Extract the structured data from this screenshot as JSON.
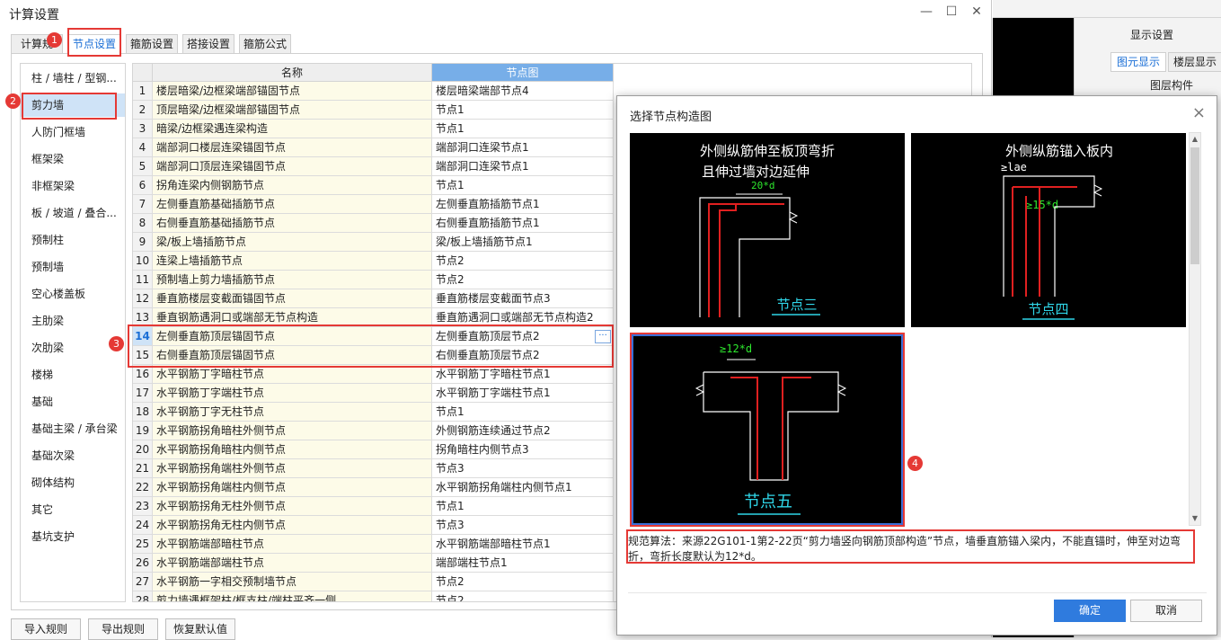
{
  "window": {
    "title": "计算设置"
  },
  "tabs": [
    "计算规",
    "节点设置",
    "箍筋设置",
    "搭接设置",
    "箍筋公式"
  ],
  "sidebar": {
    "items": [
      "柱 / 墙柱 / 型钢...",
      "剪力墙",
      "人防门框墙",
      "框架梁",
      "非框架梁",
      "板 / 坡道 / 叠合...",
      "预制柱",
      "预制墙",
      "空心楼盖板",
      "主肋梁",
      "次肋梁",
      "楼梯",
      "基础",
      "基础主梁 / 承台梁",
      "基础次梁",
      "砌体结构",
      "其它",
      "基坑支护"
    ],
    "selected": 1
  },
  "grid": {
    "headers": {
      "name": "名称",
      "node": "节点图"
    },
    "rows": [
      [
        "1",
        "楼层暗梁/边框梁端部锚固节点",
        "楼层暗梁端部节点4"
      ],
      [
        "2",
        "顶层暗梁/边框梁端部锚固节点",
        "节点1"
      ],
      [
        "3",
        "暗梁/边框梁遇连梁构造",
        "节点1"
      ],
      [
        "4",
        "端部洞口楼层连梁锚固节点",
        "端部洞口连梁节点1"
      ],
      [
        "5",
        "端部洞口顶层连梁锚固节点",
        "端部洞口连梁节点1"
      ],
      [
        "6",
        "拐角连梁内侧钢筋节点",
        "节点1"
      ],
      [
        "7",
        "左侧垂直筋基础插筋节点",
        "左侧垂直筋插筋节点1"
      ],
      [
        "8",
        "右侧垂直筋基础插筋节点",
        "右侧垂直筋插筋节点1"
      ],
      [
        "9",
        "梁/板上墙插筋节点",
        "梁/板上墙插筋节点1"
      ],
      [
        "10",
        "连梁上墙插筋节点",
        "节点2"
      ],
      [
        "11",
        "预制墙上剪力墙插筋节点",
        "节点2"
      ],
      [
        "12",
        "垂直筋楼层变截面锚固节点",
        "垂直筋楼层变截面节点3"
      ],
      [
        "13",
        "垂直钢筋遇洞口或端部无节点构造",
        "垂直筋遇洞口或端部无节点构造2"
      ],
      [
        "14",
        "左侧垂直筋顶层锚固节点",
        "左侧垂直筋顶层节点2"
      ],
      [
        "15",
        "右侧垂直筋顶层锚固节点",
        "右侧垂直筋顶层节点2"
      ],
      [
        "16",
        "水平钢筋丁字暗柱节点",
        "水平钢筋丁字暗柱节点1"
      ],
      [
        "17",
        "水平钢筋丁字端柱节点",
        "水平钢筋丁字端柱节点1"
      ],
      [
        "18",
        "水平钢筋丁字无柱节点",
        "节点1"
      ],
      [
        "19",
        "水平钢筋拐角暗柱外侧节点",
        "外侧钢筋连续通过节点2"
      ],
      [
        "20",
        "水平钢筋拐角暗柱内侧节点",
        "拐角暗柱内侧节点3"
      ],
      [
        "21",
        "水平钢筋拐角端柱外侧节点",
        "节点3"
      ],
      [
        "22",
        "水平钢筋拐角端柱内侧节点",
        "水平钢筋拐角端柱内侧节点1"
      ],
      [
        "23",
        "水平钢筋拐角无柱外侧节点",
        "节点1"
      ],
      [
        "24",
        "水平钢筋拐角无柱内侧节点",
        "节点3"
      ],
      [
        "25",
        "水平钢筋端部暗柱节点",
        "水平钢筋端部暗柱节点1"
      ],
      [
        "26",
        "水平钢筋端部端柱节点",
        "端部端柱节点1"
      ],
      [
        "27",
        "水平钢筋一字相交预制墙节点",
        "节点2"
      ],
      [
        "28",
        "剪力墙遇框架柱/框支柱/端柱平齐一侧",
        "节点2"
      ]
    ],
    "selected_row": 14,
    "ellipsis": "···"
  },
  "bottom_buttons": [
    "导入规则",
    "导出规则",
    "恢复默认值"
  ],
  "annotations": [
    "1",
    "2",
    "3",
    "4"
  ],
  "right_panel": {
    "title": "显示设置",
    "tabs": [
      "图元显示",
      "楼层显示"
    ],
    "layer": "图层构件"
  },
  "dialog": {
    "title": "选择节点构造图",
    "close": "×",
    "nodes": [
      {
        "caption": "节点三",
        "text1": "外侧纵筋伸至板顶弯折",
        "text2": "且伸过墙对边延伸",
        "dim": "20*d"
      },
      {
        "caption": "节点四",
        "text1": "外侧纵筋锚入板内",
        "dim1": "≥lae",
        "dim2": "≥15*d"
      },
      {
        "caption": "节点五",
        "dim": "≥12*d"
      }
    ],
    "description": "规范算法：来源22G101-1第2-22页“剪力墙竖向钢筋顶部构造”节点，墙垂直筋锚入梁内，不能直锚时，伸至对边弯折，弯折长度默认为12*d。",
    "ok": "确定",
    "cancel": "取消"
  },
  "colors": {
    "accent": "#1b6fd6",
    "annotation": "#e53935",
    "primary_button": "#2f7bde",
    "rebar": "#e02020",
    "caption": "#2fd6e8",
    "dimension": "#2ee82e"
  }
}
